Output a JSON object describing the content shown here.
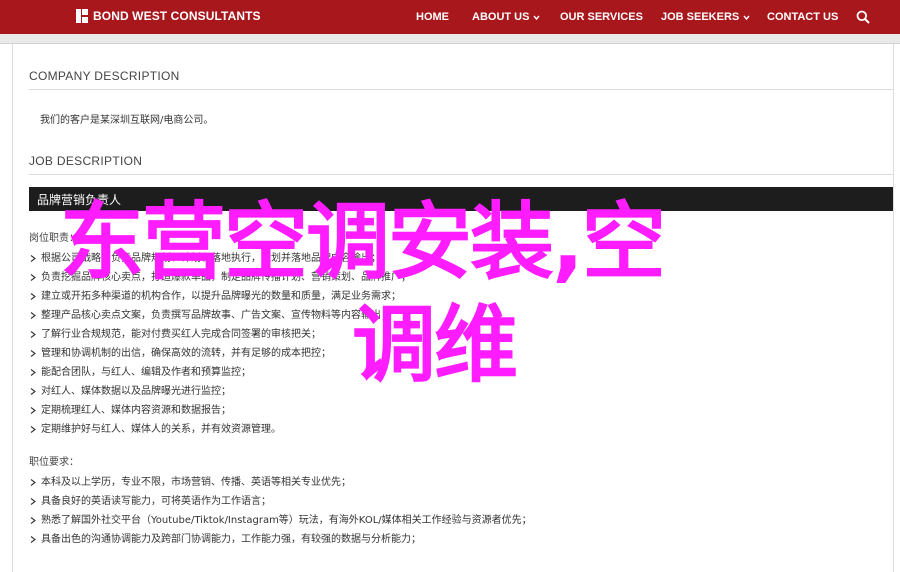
{
  "brand": {
    "name": "BOND WEST CONSULTANTS",
    "color": "#a8171c"
  },
  "nav": {
    "items": [
      {
        "label": "HOME",
        "has_dropdown": false
      },
      {
        "label": "ABOUT US",
        "has_dropdown": true
      },
      {
        "label": "OUR SERVICES",
        "has_dropdown": false
      },
      {
        "label": "JOB SEEKERS",
        "has_dropdown": true
      },
      {
        "label": "CONTACT US",
        "has_dropdown": false
      }
    ],
    "search_icon": "search-icon"
  },
  "company": {
    "heading": "COMPANY DESCRIPTION",
    "text": "我们的客户是某深圳互联网/电商公司。"
  },
  "job": {
    "heading": "JOB DESCRIPTION",
    "title": "品牌营销负责人",
    "duties_label": "岗位职责：",
    "duties": [
      "根据公司战略，负责品牌规划、计划和落地执行，策划并落地品牌内容输出；",
      "负责挖掘品牌核心卖点，打造爆款单品，制定品牌传播计划、营销策划、品牌推广；",
      "建立或开拓多种渠道的机构合作，以提升品牌曝光的数量和质量，满足业务需求；",
      "整理产品核心卖点文案，负责撰写品牌故事、广告文案、宣传物料等内容输出；",
      "了解行业合规规范，能对付费买红人完成合同签署的审核把关；",
      "管理和协调机制的出信，确保高效的流转，并有足够的成本把控；",
      "能配合团队，与红人、编辑及作者和预算监控；",
      "对红人、媒体数据以及品牌曝光进行监控；",
      "定期梳理红人、媒体内容资源和数据报告；",
      "定期维护好与红人、媒体人的关系，并有效资源管理。"
    ],
    "requirements_label": "职位要求：",
    "requirements": [
      "本科及以上学历，专业不限，市场营销、传播、英语等相关专业优先；",
      "具备良好的英语读写能力，可将英语作为工作语言；",
      "熟悉了解国外社交平台（Youtube/Tiktok/Instagram等）玩法，有海外KOL/媒体相关工作经验与资源者优先；",
      "具备出色的沟通协调能力及跨部门协调能力，工作能力强，有较强的数据与分析能力；"
    ]
  },
  "overlay": {
    "line1": "东营空调安装,空",
    "line2": "调维",
    "color": "#ff1cff"
  }
}
